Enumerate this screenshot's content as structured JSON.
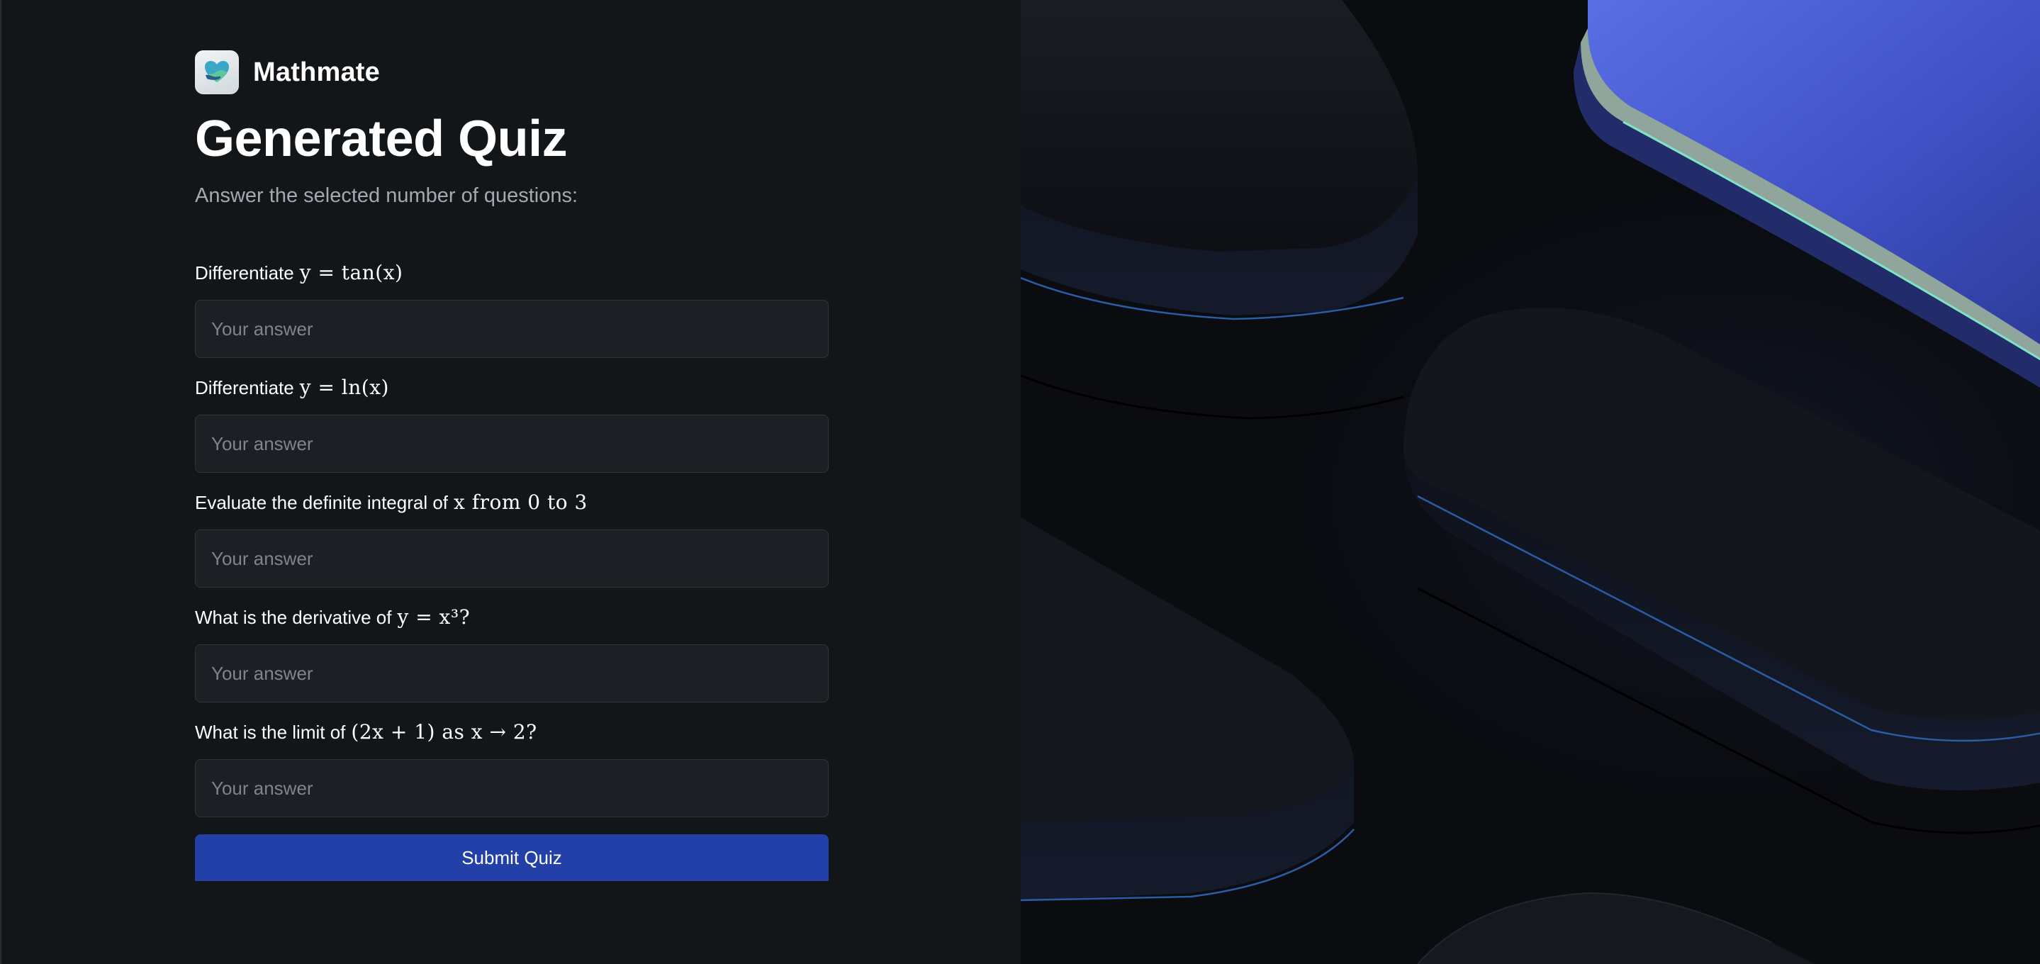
{
  "brand": {
    "name": "Mathmate",
    "logo_icon": "heart-hands-logo"
  },
  "header": {
    "title": "Generated Quiz",
    "subtitle": "Answer the selected number of questions:"
  },
  "questions": [
    {
      "text": "Differentiate",
      "math": "y = tan(x)",
      "placeholder": "Your answer",
      "value": ""
    },
    {
      "text": "Differentiate",
      "math": "y = ln(x)",
      "placeholder": "Your answer",
      "value": ""
    },
    {
      "text": "Evaluate the definite integral of",
      "math": "x from 0 to 3",
      "placeholder": "Your answer",
      "value": ""
    },
    {
      "text": "What is the derivative of",
      "math": "y = x³?",
      "placeholder": "Your answer",
      "value": ""
    },
    {
      "text": "What is the limit of",
      "math": "(2x + 1) as x → 2?",
      "placeholder": "Your answer",
      "value": ""
    }
  ],
  "submit": {
    "label": "Submit Quiz"
  },
  "colors": {
    "background": "#131619",
    "input_bg": "#1c1f23",
    "accent": "#2340a8",
    "decor_accent": "#4a5ed8"
  }
}
